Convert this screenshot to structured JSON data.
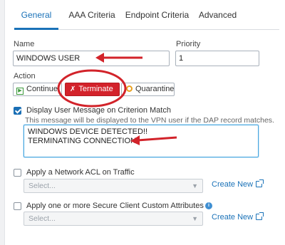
{
  "tabs": [
    {
      "label": "General",
      "active": true
    },
    {
      "label": "AAA Criteria",
      "active": false
    },
    {
      "label": "Endpoint Criteria",
      "active": false
    },
    {
      "label": "Advanced",
      "active": false
    }
  ],
  "form": {
    "name_label": "Name",
    "name_value": "WINDOWS USER",
    "priority_label": "Priority",
    "priority_value": "1",
    "action_label": "Action",
    "actions": {
      "continue": "Continue",
      "terminate": "Terminate",
      "quarantine": "Quarantine",
      "selected": "Terminate"
    },
    "display_message": {
      "checked": true,
      "label": "Display User Message on Criterion Match",
      "help": "This message will be displayed to the VPN user if the DAP record matches.",
      "lines": [
        "WINDOWS DEVICE DETECTED!!",
        "TERMINATING CONNECTION!"
      ]
    },
    "network_acl": {
      "checked": false,
      "label": "Apply a Network ACL on Traffic",
      "placeholder": "Select...",
      "create_new": "Create New"
    },
    "custom_attrs": {
      "checked": false,
      "label": "Apply one or more Secure Client Custom Attributes",
      "placeholder": "Select...",
      "create_new": "Create New"
    }
  },
  "colors": {
    "accent": "#1a72b8",
    "terminate": "#d3222a",
    "annotation": "#d2232a"
  },
  "icons": [
    "continue-icon",
    "terminate-icon",
    "quarantine-icon",
    "chevron-down-icon",
    "external-link-icon",
    "info-icon",
    "checkmark-icon"
  ]
}
